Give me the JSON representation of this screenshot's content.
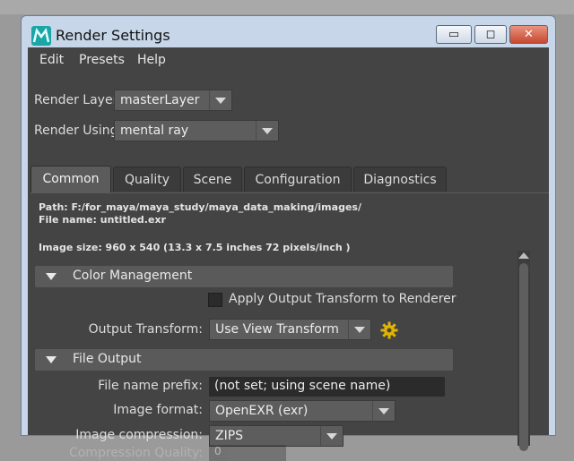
{
  "window": {
    "title": "Render Settings",
    "buttons": {
      "minimize": "▭",
      "maximize": "◻",
      "close": "✕"
    }
  },
  "menu": [
    "Edit",
    "Presets",
    "Help"
  ],
  "render_layer": {
    "label": "Render Layer",
    "value": "masterLayer"
  },
  "render_using": {
    "label": "Render Using",
    "value": "mental ray"
  },
  "tabs": [
    "Common",
    "Quality",
    "Scene",
    "Configuration",
    "Diagnostics"
  ],
  "active_tab": "Common",
  "info": {
    "path": "Path: F:/for_maya/maya_study/maya_data_making/images/",
    "file_name": "File name:  untitled.exr",
    "image_size": "Image size: 960 x 540 (13.3 x 7.5 inches 72 pixels/inch )"
  },
  "color_management": {
    "header": "Color Management",
    "apply_output_transform": {
      "label": "Apply Output Transform to Renderer",
      "checked": false
    },
    "output_transform": {
      "label": "Output Transform:",
      "value": "Use View Transform"
    }
  },
  "file_output": {
    "header": "File Output",
    "file_name_prefix": {
      "label": "File name prefix:",
      "value": "(not set; using scene name)"
    },
    "image_format": {
      "label": "Image format:",
      "value": "OpenEXR (exr)"
    },
    "image_compression": {
      "label": "Image compression:",
      "value": "ZIPS"
    },
    "compression_quality": {
      "label": "Compression Quality:",
      "value": "0"
    }
  },
  "colors": {
    "accent_gear": "#e0b400",
    "panel_bg": "#444444",
    "section_bg": "#5a5a5a"
  }
}
